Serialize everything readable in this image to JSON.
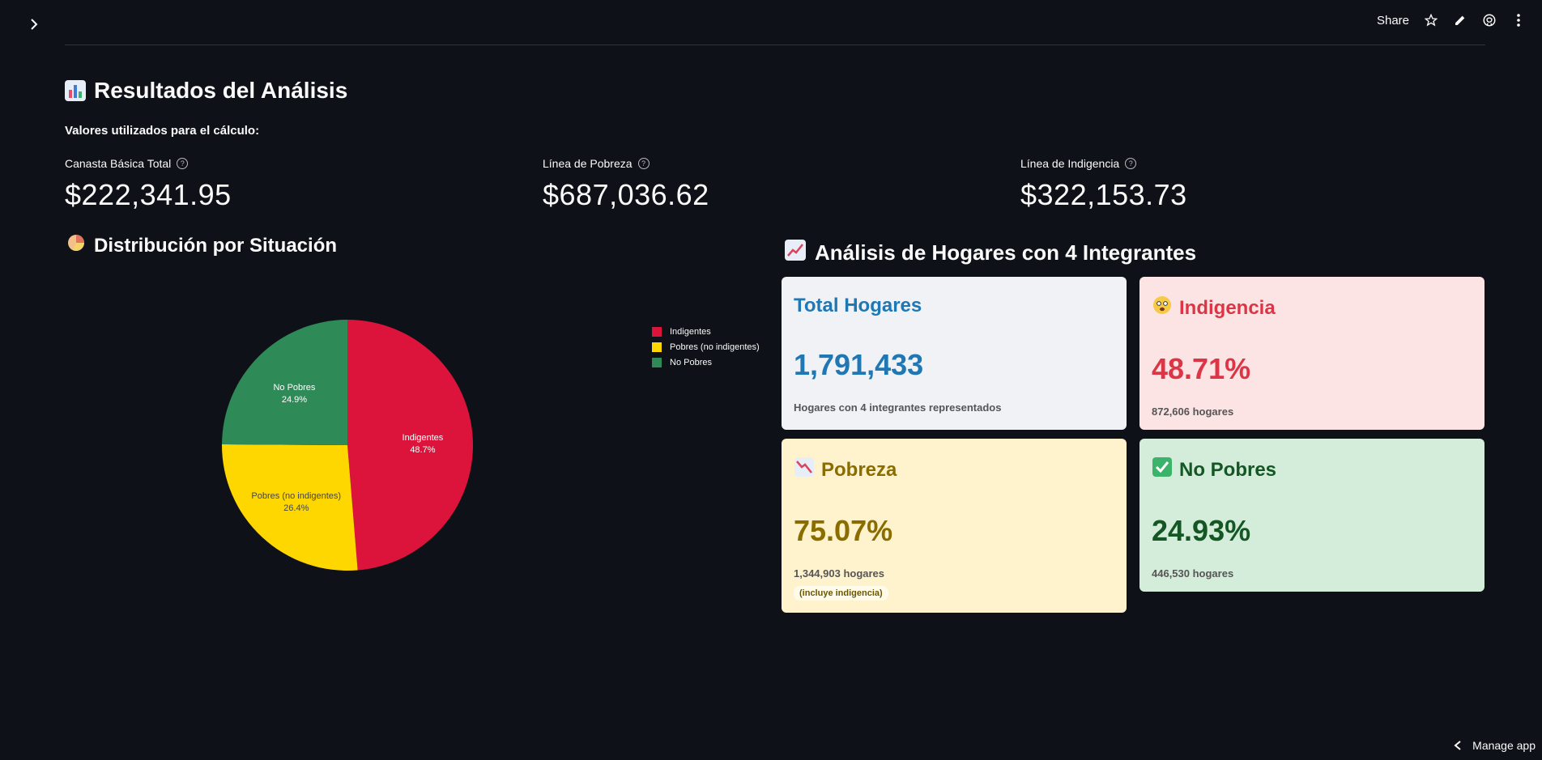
{
  "topbar": {
    "share_label": "Share",
    "icons": [
      "star-icon",
      "edit-icon",
      "github-icon",
      "more-vertical-icon"
    ]
  },
  "header": {
    "title": "Resultados del Análisis",
    "subtitle": "Valores utilizados para el cálculo:"
  },
  "metrics": [
    {
      "label": "Canasta Básica Total",
      "value": "$222,341.95"
    },
    {
      "label": "Línea de Pobreza",
      "value": "$687,036.62"
    },
    {
      "label": "Línea de Indigencia",
      "value": "$322,153.73"
    }
  ],
  "distribution": {
    "title": "Distribución por Situación"
  },
  "chart_data": {
    "type": "pie",
    "slices": [
      {
        "label": "Indigentes",
        "value": 48.7,
        "display": "48.7%",
        "color": "#dc143c"
      },
      {
        "label": "Pobres (no indigentes)",
        "value": 26.4,
        "display": "26.4%",
        "color": "#ffd700"
      },
      {
        "label": "No Pobres",
        "value": 24.9,
        "display": "24.9%",
        "color": "#2e8b57"
      }
    ],
    "legend": [
      "Indigentes",
      "Pobres (no indigentes)",
      "No Pobres"
    ],
    "legend_position": "top-right"
  },
  "analysis": {
    "title": "Análisis de Hogares con 4 Integrantes",
    "cards": {
      "total": {
        "title": "Total Hogares",
        "value": "1,791,433",
        "sub": "Hogares con 4 integrantes representados"
      },
      "indigencia": {
        "title": "Indigencia",
        "value": "48.71%",
        "sub": "872,606 hogares"
      },
      "pobreza": {
        "title": "Pobreza",
        "value": "75.07%",
        "sub": "1,344,903 hogares",
        "note": "(incluye indigencia)"
      },
      "nopobres": {
        "title": "No Pobres",
        "value": "24.93%",
        "sub": "446,530 hogares"
      }
    }
  },
  "footer": {
    "manage_label": "Manage app"
  },
  "colors": {
    "background": "#0e1117",
    "total_accent": "#1f77b4",
    "indigencia_accent": "#dc3545",
    "pobreza_accent": "#8a6d00",
    "nopobres_accent": "#155724"
  }
}
